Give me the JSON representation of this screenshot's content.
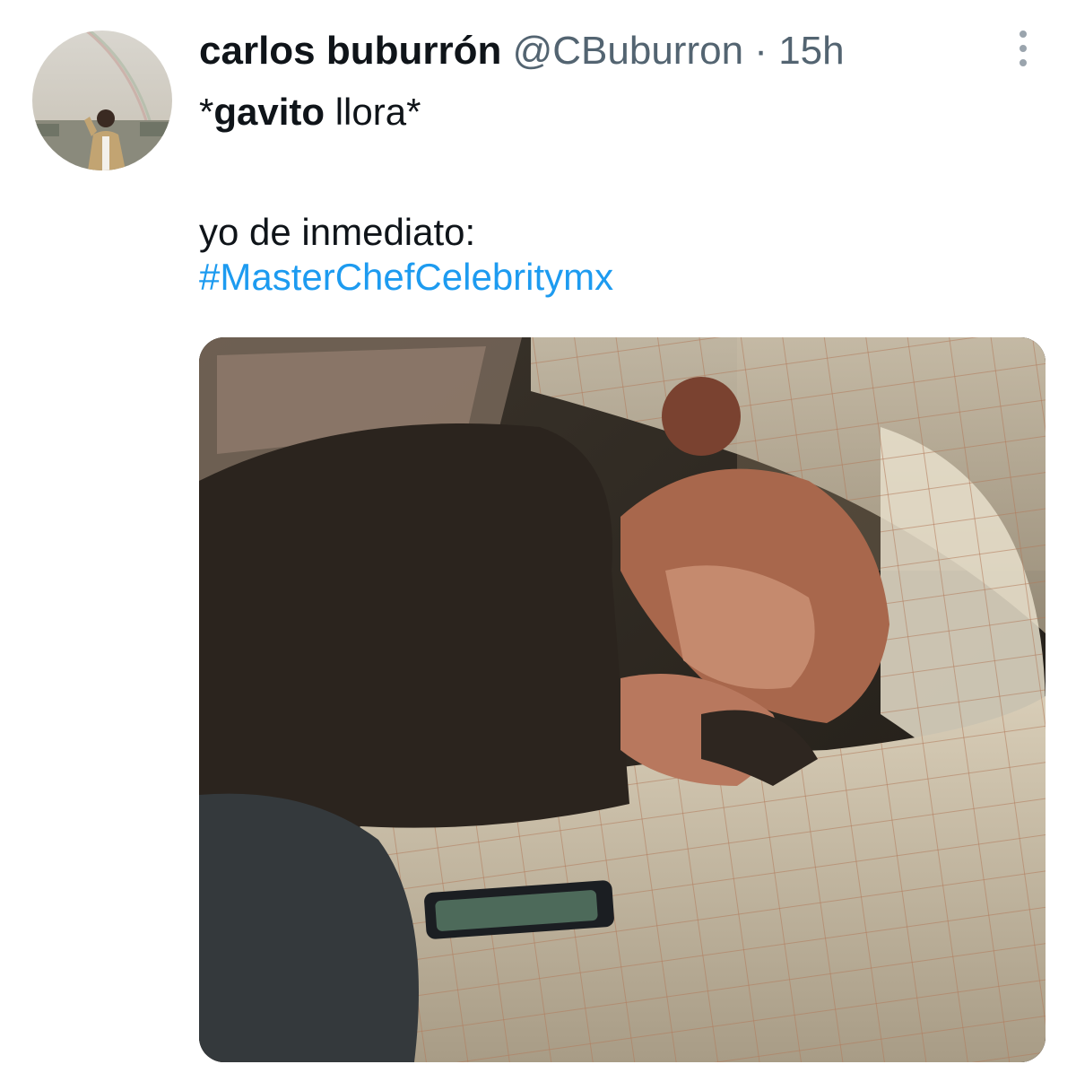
{
  "tweet": {
    "author": {
      "display_name": "carlos buburrón",
      "handle": "@CBuburron",
      "separator": "·",
      "timestamp": "15h"
    },
    "more_icon": "more-horizontal-icon",
    "text": {
      "line1_bold": "gavito",
      "line1_prefix": "*",
      "line1_suffix": " llora*",
      "line2": "yo de inmediato:",
      "hashtag": "#MasterChefCelebritymx"
    },
    "colors": {
      "hashtag": "#1d9bf0",
      "secondary_text": "#536471",
      "primary_text": "#0f1419"
    }
  }
}
